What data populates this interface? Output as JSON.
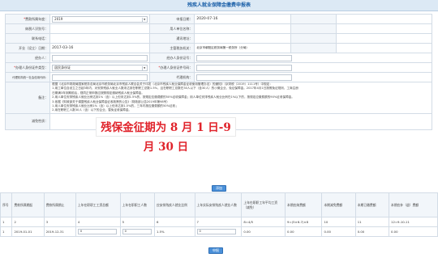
{
  "page_title": "残疾人就业保障金缴费申报表",
  "form": {
    "tax_period_label": "费款所属年度：",
    "tax_period_value": "2019",
    "declare_date_label": "申报日期：",
    "declare_date_value": "2020-07-16",
    "taxpayer_id_label": "纳税人识别号：",
    "payer_name_label": "用人单位名称：",
    "contact_phone_label": "联系电话：",
    "address_label": "通讯地址：",
    "open_date_label": "开业（设立）日期：",
    "open_date_value": "2017-03-16",
    "tax_authority_label": "主管税务机关：",
    "tax_authority_value": "北京市朝阳区税务局第一税务所（分局）",
    "agent_label": "经办人：",
    "agent_id_label": "经办人身份证号：",
    "rep_id_type_label": "办理人身份证件类型：",
    "rep_id_type_value": "居民身份证",
    "rep_id_no_label": "办理人身份证件号码：",
    "rep_rel_label": "代理机构统一社会信用代码：",
    "rep_name_label": "代理机构："
  },
  "remark": {
    "label": "备注：",
    "line1": "根据《北京市财政局国家税务总局北京市税务局北京市残疾人联合会关于印发〈北京市残疾人就业保障金征收使用管理办法〉的通知》（京财税〔2019〕1111号）中规定：",
    "line2": "1.用工单位自设立之日起3年内，对安排残疾人就业人数未达到在职职工总数1.5%，且在职职工总数在30人以下（含30人）的小微企业，免征保障金。2017年4月1日按照免征规则，工商注册",
    "line3": "日期满3年到期前后，视同正常申报应按照规定缴纳残疾人就业保障金。",
    "line4": "2.用人单位安排残疾人就业比例达到1%（含）以上但未达到1.5%的，按规定应缴费额的50%征收保障金；用人单位安排残疾人就业比例在1%以下的，按规定应缴费额的90%征收保障金。",
    "line5": "3.依据《财政部关于调整残疾人就业保障金征收政策的公告》（财政部公告2019年第98号）",
    "line6": "1.用人单位安排残疾人就业比例1%（含）以上但未达到1.5%的，三年内按应缴费额的50%征收；",
    "line7": "2.用在职职工人数30人（含）以下的企业，暂免征收保障金。",
    "reduction_label": "减免性质："
  },
  "banner_text": "残保金征期为 8 月 1 日-9 月 30 日",
  "buttons": {
    "add_label": "添加",
    "submit_label": "申报"
  },
  "grid": {
    "headers": [
      "序号",
      "费款所属期起",
      "费款所属期止",
      "上年在职职工工资总额",
      "上年在职职工人数",
      "应安排残疾人就业比例",
      "上年实际安排残疾人就业人数",
      "上年在职职工年平均工资（减免）",
      "本期应纳费额",
      "本期减免费额",
      "本期已缴费额",
      "本期应补（退）费额"
    ],
    "formula_row": [
      "1",
      "2",
      "3",
      "4",
      "5",
      "6",
      "7",
      "8=4/5",
      "9=(5×6-7)×8",
      "10",
      "11",
      "12=9-10-11"
    ],
    "data_row": [
      "1",
      "2019-01-01",
      "2019-12-31",
      "0",
      "0",
      "1.5%",
      "0",
      "0.00",
      "0.00",
      "0.00",
      "0.00",
      "0.00"
    ]
  }
}
